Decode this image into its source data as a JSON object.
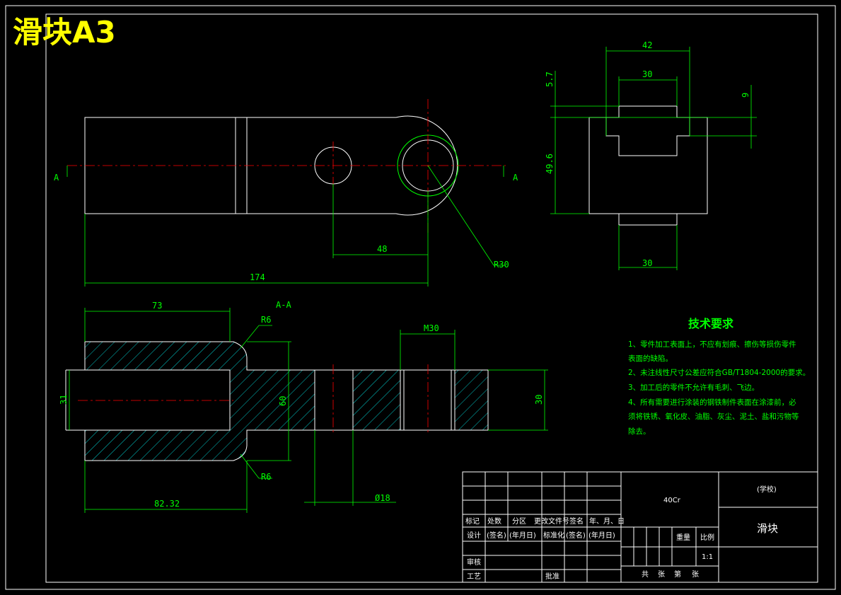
{
  "title": "滑块A3",
  "section": {
    "label": "A-A",
    "cut_left": "A",
    "cut_right": "A"
  },
  "dims": {
    "d42": "42",
    "d30_top": "30",
    "d5_7": "5.7",
    "d9": "9",
    "d49_6": "49.6",
    "d30_bottom": "30",
    "d48": "48",
    "d174": "174",
    "r30": "R30",
    "d73": "73",
    "r6_top": "R6",
    "r6_bottom": "R6",
    "m30": "M30",
    "d31": "31",
    "d60": "60",
    "d30_right": "30",
    "d18": "Ø18",
    "d82_32": "82.32"
  },
  "tech": {
    "heading": "技术要求",
    "lines": [
      "1、零件加工表面上，不应有划痕、擦伤等损伤零件",
      "表面的缺陷。",
      "2、未注线性尺寸公差应符合GB/T1804-2000的要求。",
      "3、加工后的零件不允许有毛刺、飞边。",
      "4、所有需要进行涂装的钢铁制件表面在涂漆前，必",
      "须将铁锈、氧化皮、油脂、灰尘、泥土、盐和污物等",
      "除去。"
    ]
  },
  "titleblock": {
    "row_labels": [
      "标记",
      "处数",
      "分区",
      "更改文件号",
      "签名",
      "年、月、日"
    ],
    "sign_row": [
      "设计",
      "(签名)",
      "(年月日)",
      "标准化",
      "(签名)",
      "(年月日)"
    ],
    "material": "40Cr",
    "school": "(学校)",
    "part_name": "滑块",
    "weight_label": "重量",
    "scale_label": "比例",
    "scale": "1:1",
    "review": "审核",
    "process": "工艺",
    "approve": "批准",
    "sheets": [
      "共",
      "张",
      "第",
      "张"
    ]
  },
  "colors": {
    "outline": "#ffffff",
    "dimension": "#00ff00",
    "center": "#ff0000",
    "hatch": "#00ffff",
    "title": "#ffff00"
  }
}
